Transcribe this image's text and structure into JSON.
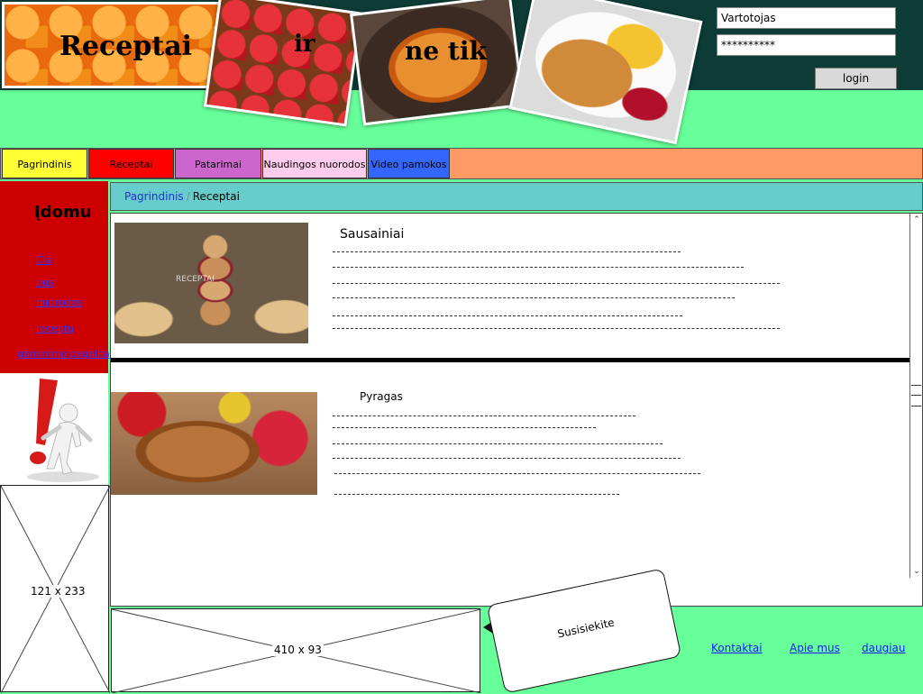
{
  "header": {
    "title_word1": "Receptai",
    "title_word2": "ir",
    "title_word3": "ne tik",
    "username_value": "Vartotojas",
    "password_value": "**********",
    "login_label": "login"
  },
  "nav": {
    "items": [
      {
        "label": "Pagrindinis",
        "color": "#ffff33"
      },
      {
        "label": "Receptai",
        "color": "#ff0000"
      },
      {
        "label": "Patarimai",
        "color": "#cc66cc"
      },
      {
        "label": "Naudingos nuorodos",
        "color": "#ffccee"
      },
      {
        "label": "Video pamokos",
        "color": "#3366ff"
      }
    ]
  },
  "sidebar": {
    "title": "Įdomu",
    "links": [
      "Čia",
      "bus",
      "nuorodos",
      "receptų",
      "gaminimo pagalba"
    ],
    "placeholder_label": "121 x 233"
  },
  "breadcrumb": {
    "home": "Pagrindinis",
    "separator": "/",
    "current": "Receptai"
  },
  "recipes": [
    {
      "title": "Sausainiai",
      "image_watermark": "RECEPTAI"
    },
    {
      "title": "Pyragas"
    }
  ],
  "footer": {
    "placeholder_label": "410 x 93",
    "contact_bubble": "Susisiekite",
    "links": [
      "Kontaktai",
      "Apie mus",
      "daugiau"
    ]
  },
  "colors": {
    "background": "#66ff99",
    "header_bg": "#0d3b36",
    "sidebar_bg": "#cc0000",
    "breadcrumb_bg": "#66cccc",
    "navbar_bg": "#ff9966"
  }
}
